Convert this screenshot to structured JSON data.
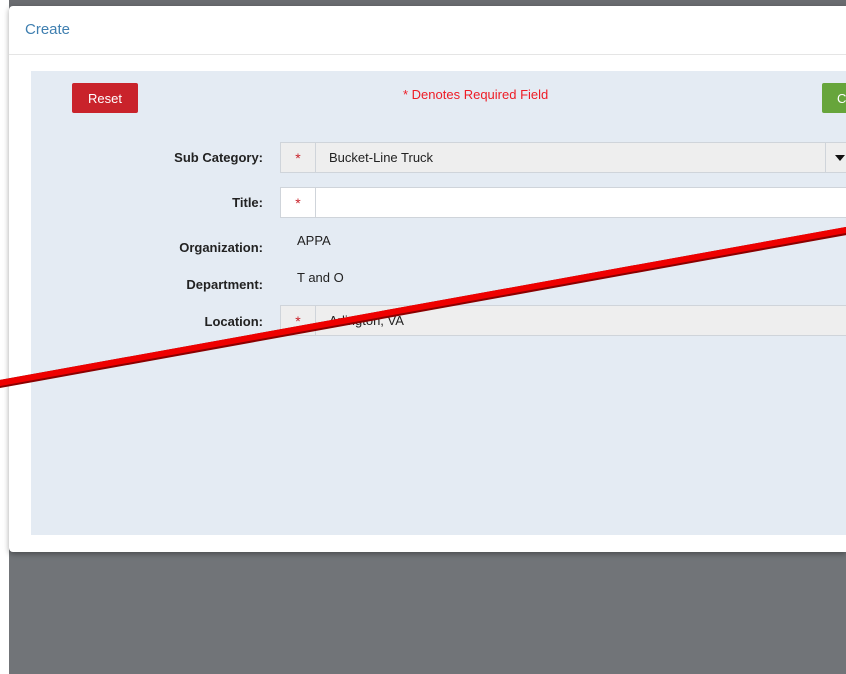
{
  "modal": {
    "title": "Create"
  },
  "toolbar": {
    "reset_label": "Reset",
    "create_label": "C",
    "required_note": "* Denotes Required Field"
  },
  "form": {
    "sub_category": {
      "label": "Sub Category:",
      "value": "Bucket-Line Truck",
      "required_marker": "*"
    },
    "title": {
      "label": "Title:",
      "value": "",
      "required_marker": "*"
    },
    "organization": {
      "label": "Organization:",
      "value": "APPA"
    },
    "department": {
      "label": "Department:",
      "value": "T and O"
    },
    "location": {
      "label": "Location:",
      "value": "Arlington, VA",
      "required_marker": "*"
    }
  },
  "colors": {
    "title_blue": "#3f7fb0",
    "reset_red": "#c9232b",
    "create_green": "#67a53b",
    "required_red": "#ee1c25",
    "panel_bg": "#e4ebf3",
    "annotation_line": "#ee0000"
  },
  "icons": {
    "dropdown": "caret-down-icon"
  }
}
